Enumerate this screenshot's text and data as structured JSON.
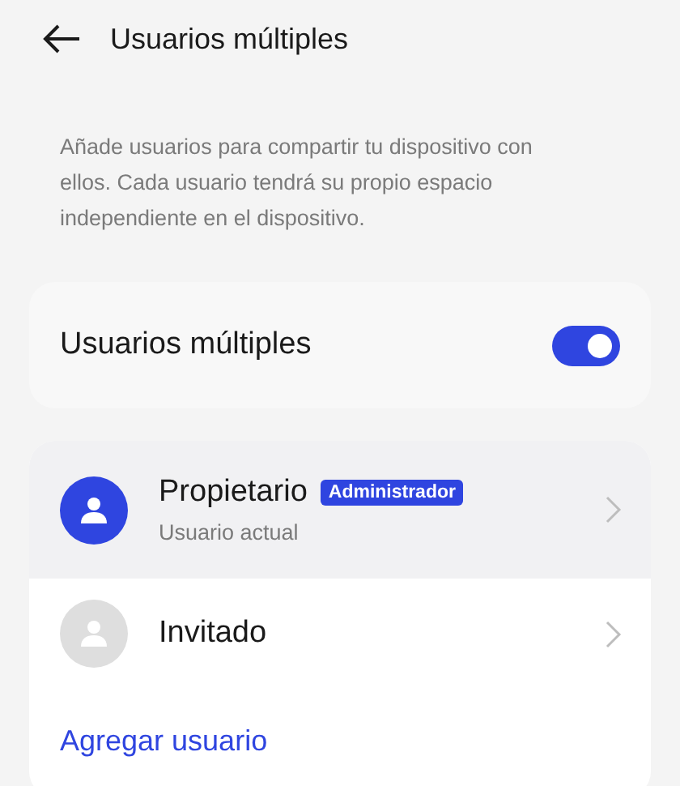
{
  "header": {
    "title": "Usuarios múltiples"
  },
  "description": "Añade usuarios para compartir tu dispositivo con ellos. Cada usuario tendrá su propio espacio independiente en el dispositivo.",
  "toggle": {
    "label": "Usuarios múltiples",
    "on": true
  },
  "users": [
    {
      "name": "Propietario",
      "badge": "Administrador",
      "subtitle": "Usuario actual",
      "current": true,
      "selected": true
    },
    {
      "name": "Invitado",
      "current": false,
      "selected": false
    }
  ],
  "add_user": "Agregar usuario"
}
